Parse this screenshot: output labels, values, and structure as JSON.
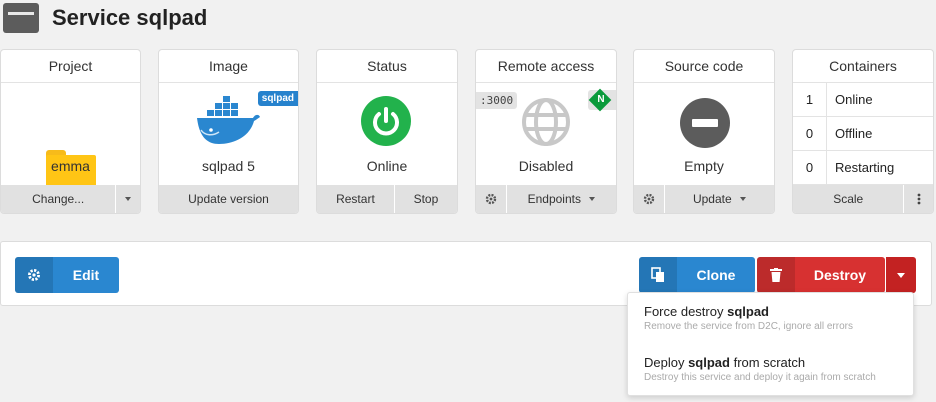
{
  "header": {
    "title": "Service sqlpad",
    "icon": "server-icon"
  },
  "cards": {
    "project": {
      "title": "Project",
      "value": "emma",
      "action": "Change...",
      "icon": "folder-icon"
    },
    "image": {
      "title": "Image",
      "value": "sqlpad 5",
      "badge": "sqlpad",
      "action": "Update version",
      "icon": "docker-whale-icon"
    },
    "status": {
      "title": "Status",
      "value": "Online",
      "actions": [
        "Restart",
        "Stop"
      ],
      "icon": "power-icon",
      "color": "#22b24c"
    },
    "remote": {
      "title": "Remote access",
      "value": "Disabled",
      "port": ":3000",
      "nginx_letter": "N",
      "action": "Endpoints",
      "icon": "globe-icon"
    },
    "source": {
      "title": "Source code",
      "value": "Empty",
      "action": "Update",
      "icon": "minus-circle-icon"
    },
    "containers": {
      "title": "Containers",
      "rows": [
        {
          "count": "1",
          "label": "Online"
        },
        {
          "count": "0",
          "label": "Offline"
        },
        {
          "count": "0",
          "label": "Restarting"
        }
      ],
      "action": "Scale"
    }
  },
  "actions": {
    "edit": "Edit",
    "clone": "Clone",
    "destroy": "Destroy"
  },
  "dropdown": {
    "items": [
      {
        "pre": "Force destroy ",
        "bold": "sqlpad",
        "post": "",
        "sub": "Remove the service from D2C, ignore all errors"
      },
      {
        "pre": "Deploy ",
        "bold": "sqlpad",
        "post": " from scratch",
        "sub": "Destroy this service and deploy it again from scratch"
      }
    ]
  },
  "colors": {
    "primary": "#2a87d0",
    "danger": "#d73131",
    "online": "#22b24c"
  }
}
